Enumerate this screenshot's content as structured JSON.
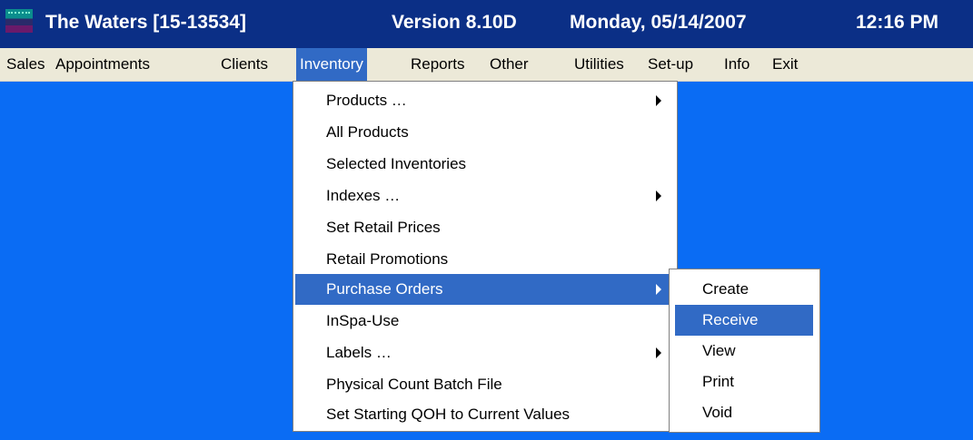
{
  "titlebar": {
    "app_name": "The Waters [15-13534]",
    "version": "Version 8.10D",
    "date": "Monday, 05/14/2007",
    "time": "12:16 PM",
    "icon": "app-icon"
  },
  "menubar": {
    "items": [
      {
        "label": "Sales"
      },
      {
        "label": "Appointments"
      },
      {
        "label": "Clients"
      },
      {
        "label": "Inventory",
        "active": true
      },
      {
        "label": "Reports"
      },
      {
        "label": "Other"
      },
      {
        "label": "Utilities"
      },
      {
        "label": "Set-up"
      },
      {
        "label": "Info"
      },
      {
        "label": "Exit"
      }
    ]
  },
  "inventory_menu": {
    "items": [
      {
        "label": "Products …",
        "submenu": true
      },
      {
        "label": "All Products"
      },
      {
        "label": "Selected Inventories"
      },
      {
        "label": "Indexes …",
        "submenu": true
      },
      {
        "label": "Set Retail Prices"
      },
      {
        "label": "Retail Promotions"
      },
      {
        "label": "Purchase Orders",
        "submenu": true,
        "highlighted": true
      },
      {
        "label": "InSpa-Use"
      },
      {
        "label": "Labels …",
        "submenu": true
      },
      {
        "label": "Physical Count Batch File"
      },
      {
        "label": "Set Starting QOH to Current Values"
      }
    ]
  },
  "purchase_orders_menu": {
    "items": [
      {
        "label": "Create"
      },
      {
        "label": "Receive",
        "highlighted": true
      },
      {
        "label": "View"
      },
      {
        "label": "Print"
      },
      {
        "label": "Void"
      }
    ]
  },
  "colors": {
    "desktop": "#0a6cf4",
    "titlebar": "#0b2f86",
    "menubar": "#ece9d8",
    "highlight": "#316ac5"
  }
}
